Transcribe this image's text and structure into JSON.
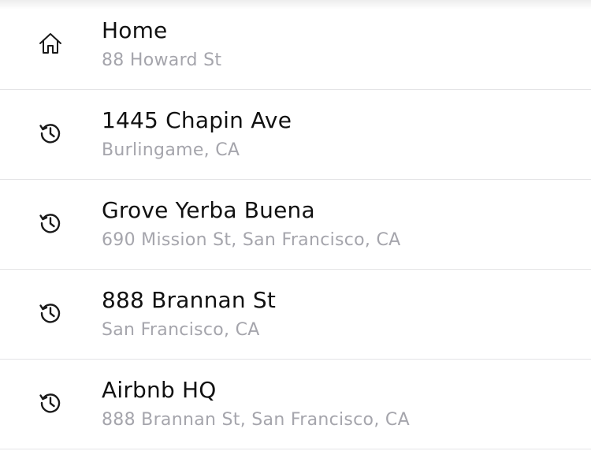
{
  "places": [
    {
      "icon": "home-icon",
      "title": "Home",
      "subtitle": "88 Howard St"
    },
    {
      "icon": "history-icon",
      "title": "1445 Chapin Ave",
      "subtitle": "Burlingame, CA"
    },
    {
      "icon": "history-icon",
      "title": "Grove Yerba Buena",
      "subtitle": "690 Mission St, San Francisco, CA"
    },
    {
      "icon": "history-icon",
      "title": "888 Brannan St",
      "subtitle": "San Francisco, CA"
    },
    {
      "icon": "history-icon",
      "title": "Airbnb HQ",
      "subtitle": "888 Brannan St, San Francisco, CA"
    }
  ],
  "colors": {
    "title": "#111111",
    "subtitle": "#a5a5ac",
    "divider": "#e4e4e6",
    "icon": "#1a1a1a"
  }
}
